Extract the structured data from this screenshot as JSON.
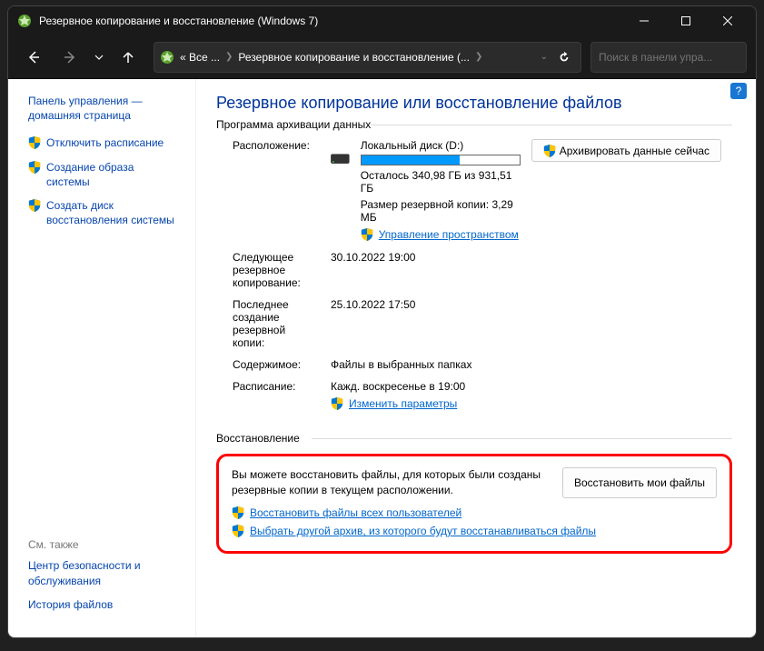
{
  "window": {
    "title": "Резервное копирование и восстановление (Windows 7)"
  },
  "nav": {
    "seg1": "« Все ...",
    "seg2": "Резервное копирование и восстановление (...",
    "search_placeholder": "Поиск в панели упра..."
  },
  "sidebar": {
    "home": "Панель управления — домашняя страница",
    "items": [
      {
        "label": "Отключить расписание"
      },
      {
        "label": "Создание образа системы"
      },
      {
        "label": "Создать диск восстановления системы"
      }
    ],
    "see_also_label": "См. также",
    "see_also": [
      "Центр безопасности и обслуживания",
      "История файлов"
    ]
  },
  "main": {
    "heading": "Резервное копирование или восстановление файлов",
    "group1": "Программа архивации данных",
    "group2": "Восстановление",
    "location": {
      "label": "Расположение:",
      "disk": "Локальный диск (D:)",
      "free_text": "Осталось 340,98 ГБ из 931,51 ГБ",
      "backup_size_text": "Размер резервной копии: 3,29 МБ",
      "manage_link": "Управление пространством",
      "progress_pct": 62,
      "btn_backup": "Архивировать данные сейчас"
    },
    "rows": [
      {
        "label": "Следующее резервное копирование:",
        "value": "30.10.2022 19:00"
      },
      {
        "label": "Последнее создание резервной копии:",
        "value": "25.10.2022 17:50"
      },
      {
        "label": "Содержимое:",
        "value": "Файлы в выбранных папках"
      },
      {
        "label": "Расписание:",
        "value": "Кажд. воскресенье в 19:00",
        "link": "Изменить параметры"
      }
    ],
    "restore": {
      "text": "Вы можете восстановить файлы, для которых были созданы резервные копии в текущем расположении.",
      "btn": "Восстановить мои файлы",
      "links": [
        "Восстановить файлы всех пользователей",
        "Выбрать другой архив, из которого будут восстанавливаться файлы"
      ]
    }
  }
}
